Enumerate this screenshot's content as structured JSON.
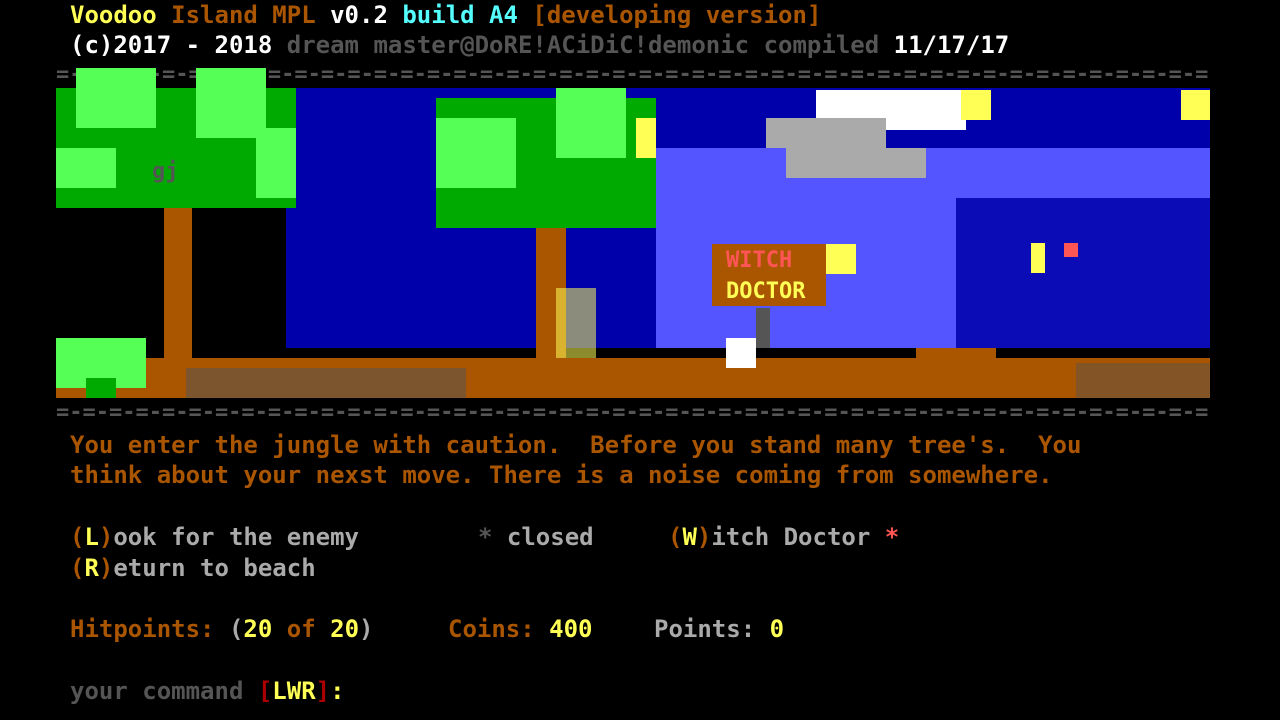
{
  "header": {
    "app_name": "Voodoo",
    "app_name2": "Island MPL",
    "version": "v0.2",
    "build": "build A4",
    "status": "[developing version]",
    "copyright_years": "(c)2017 - 2018",
    "credits": "dream master@DoRE!ACiDiC!demonic compiled",
    "compile_date": "11/17/17"
  },
  "divider_text": "=-=-=-=-=-=-=-=-=-=-=-=-=-=-=-=-=-=-=-=-=-=-=-=-=-=-=-=-=-=-=-=-=-=-=-=-=-=-=-=-=-=-=-=-=-=-=-=-=-=-=-=-=-=-=-=-=-=-=-=-=-=-=-=-=-=-=-=-=",
  "scene": {
    "carving": "gj",
    "sign_line1": "WITCH",
    "sign_line2": "DOCTOR"
  },
  "narrative": {
    "line1": "You enter the jungle with caution.  Before you stand many tree's.  You",
    "line2": "think about your nexst move. There is a noise coming from somewhere."
  },
  "menu": {
    "look_key": "L",
    "look_label": "ook for the enemy",
    "closed_marker": "*",
    "closed_label": "closed",
    "witch_key": "W",
    "witch_label": "itch Doctor",
    "witch_marker": "*",
    "return_key": "R",
    "return_label": "eturn to beach"
  },
  "stats": {
    "hp_label": "Hitpoints:",
    "hp_current": "20",
    "hp_of": "of",
    "hp_max": "20",
    "coins_label": "Coins:",
    "coins_value": "400",
    "points_label": "Points:",
    "points_value": "0"
  },
  "prompt": {
    "label": "your command",
    "keys": "LWR",
    "suffix": ":"
  },
  "colors": {
    "ansi_yellow": "#ffff55",
    "ansi_brown": "#aa5500",
    "ansi_cyan": "#55ffff",
    "ansi_red": "#aa0000",
    "ansi_light_red": "#ff5555",
    "ansi_gray": "#aaaaaa",
    "ansi_dark_gray": "#555555",
    "ansi_blue": "#0000aa",
    "ansi_light_blue": "#5555ff",
    "ansi_green": "#00aa00",
    "ansi_light_green": "#55ff55"
  }
}
